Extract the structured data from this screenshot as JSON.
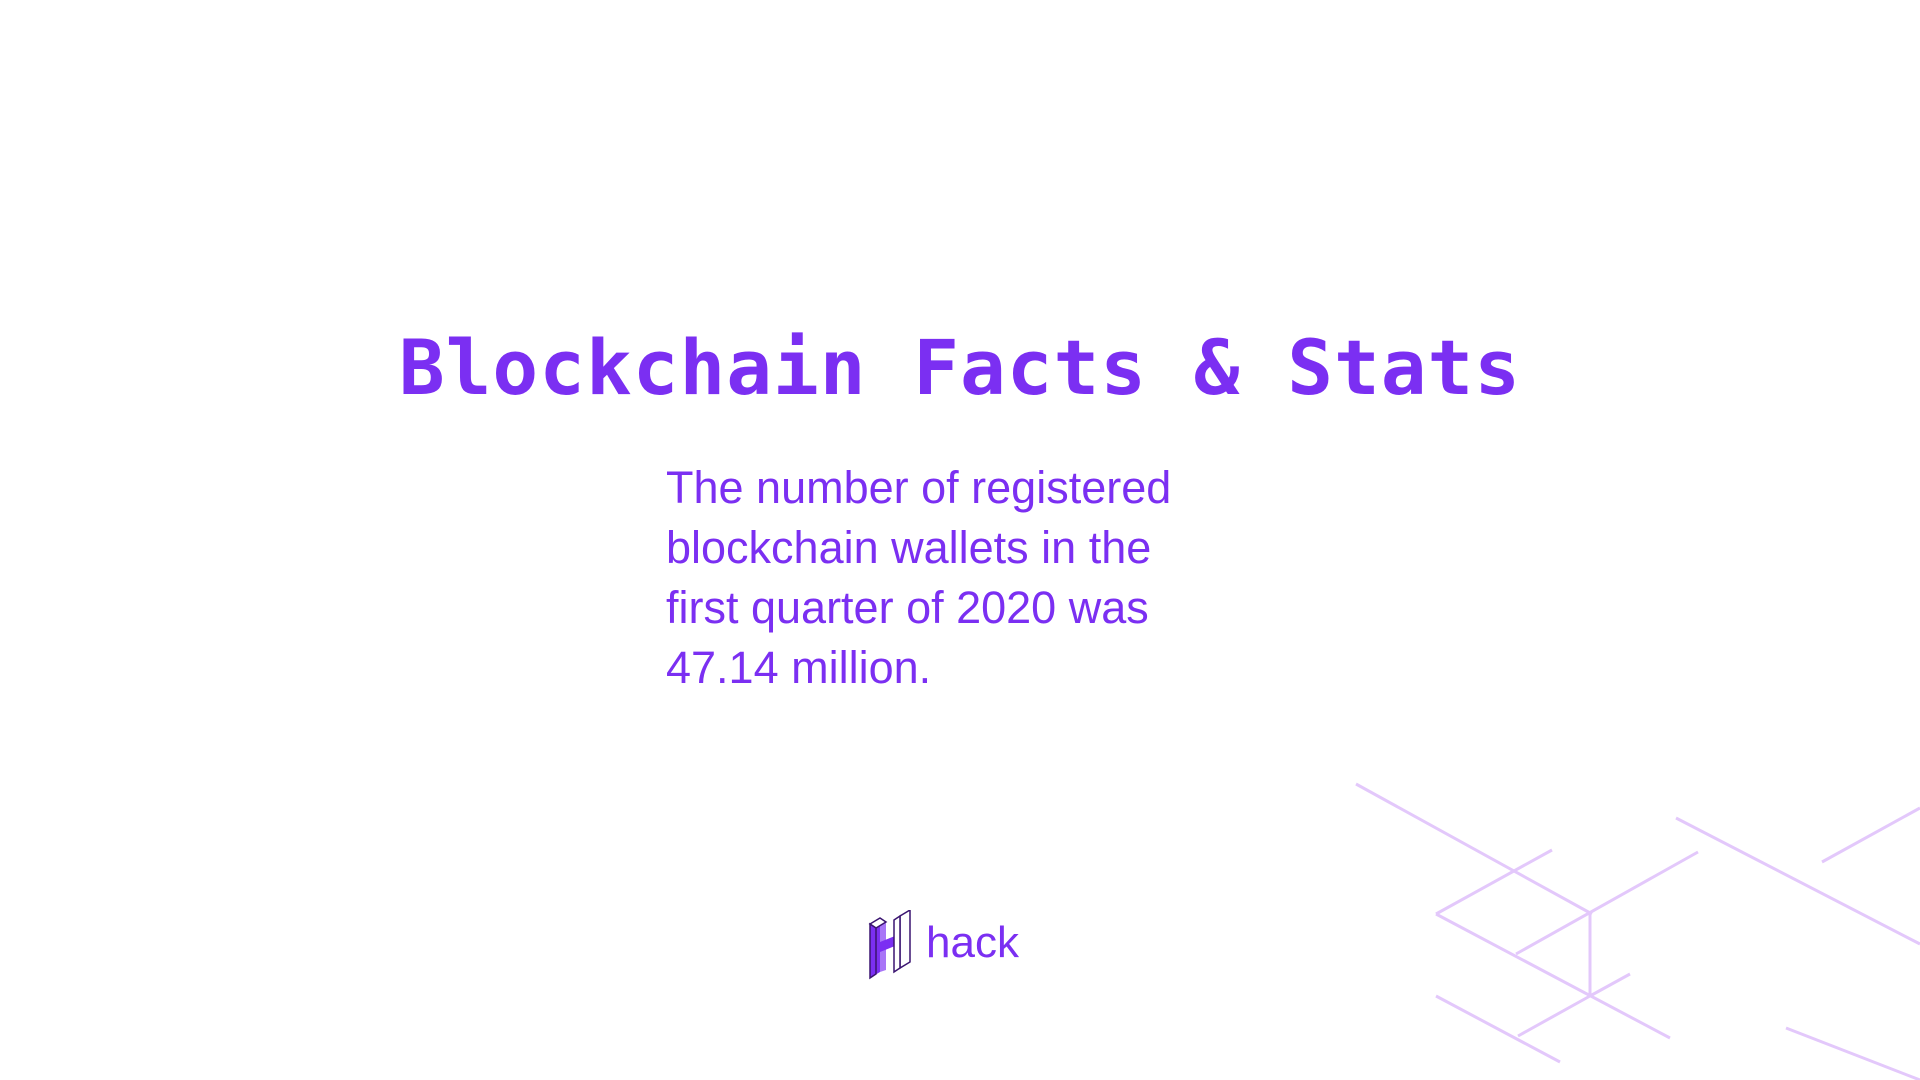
{
  "slide": {
    "title": "Blockchain Facts & Stats",
    "body": "The number of registered blockchain wallets in the first quarter of 2020 was 47.14 million."
  },
  "logo": {
    "wordmark": "hack",
    "icon": "hack-h-logo-icon"
  },
  "colors": {
    "accent": "#7b2ff2",
    "decor_lines": "#e3c8fb",
    "background": "#ffffff"
  }
}
